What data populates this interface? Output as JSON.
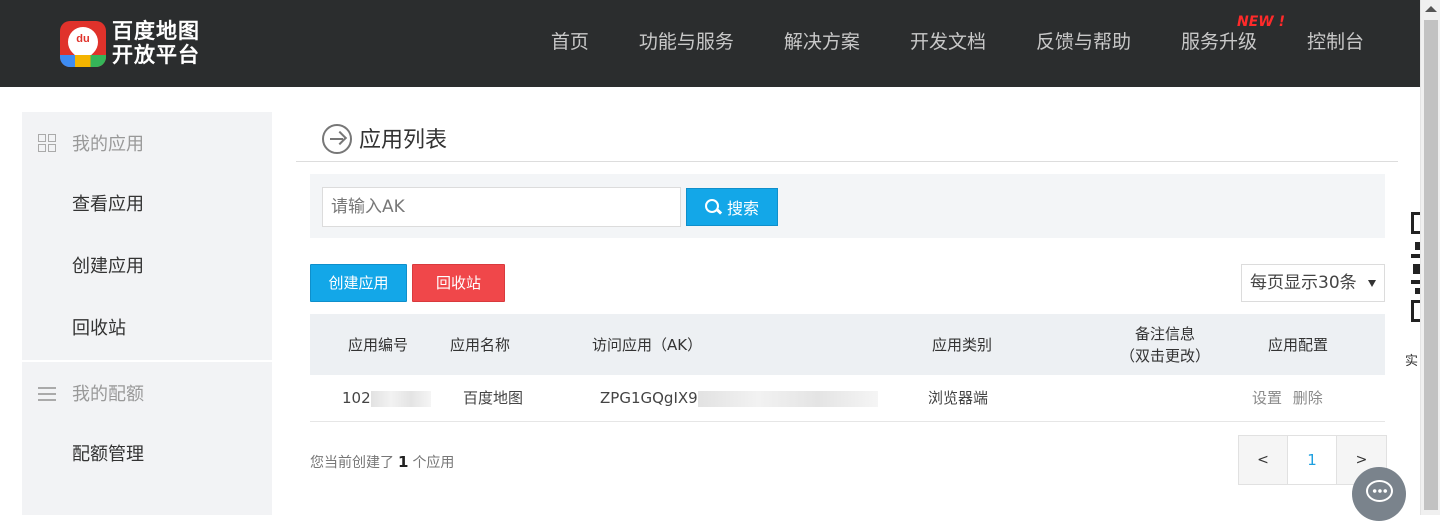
{
  "header": {
    "logo_line1": "百度地图",
    "logo_line2": "开放平台",
    "logo_badge": "du",
    "nav": [
      "首页",
      "功能与服务",
      "解决方案",
      "开发文档",
      "反馈与帮助",
      "服务升级",
      "控制台"
    ],
    "new_badge": "NEW !"
  },
  "sidebar": {
    "group1": "我的应用",
    "items1": [
      "查看应用",
      "创建应用",
      "回收站"
    ],
    "group2": "我的配额",
    "items2": [
      "配额管理"
    ],
    "group1_icon": "grid-icon",
    "group2_icon": "list-icon"
  },
  "main": {
    "title": "应用列表",
    "search_placeholder": "请输入AK",
    "search_button": "搜索",
    "create_button": "创建应用",
    "recycle_button": "回收站",
    "per_page": "每页显示30条",
    "columns": [
      "应用编号",
      "应用名称",
      "访问应用（AK）",
      "应用类别",
      "备注信息",
      "（双击更改）",
      "应用配置"
    ],
    "row": {
      "id": "102",
      "name": "百度地图",
      "ak": "ZPG1GQgIX9",
      "category": "浏览器端",
      "note": "",
      "action_settings": "设置",
      "action_delete": "删除"
    },
    "summary_prefix": "您当前创建了",
    "summary_count": "1",
    "summary_suffix": "个应用",
    "pager": [
      "<",
      "1",
      ">"
    ]
  },
  "right": {
    "qr_label": "实"
  },
  "colors": {
    "header_bg": "#2b2d2e",
    "primary": "#13a7e8",
    "danger": "#f0474a",
    "new_badge": "#ff2a2a"
  }
}
